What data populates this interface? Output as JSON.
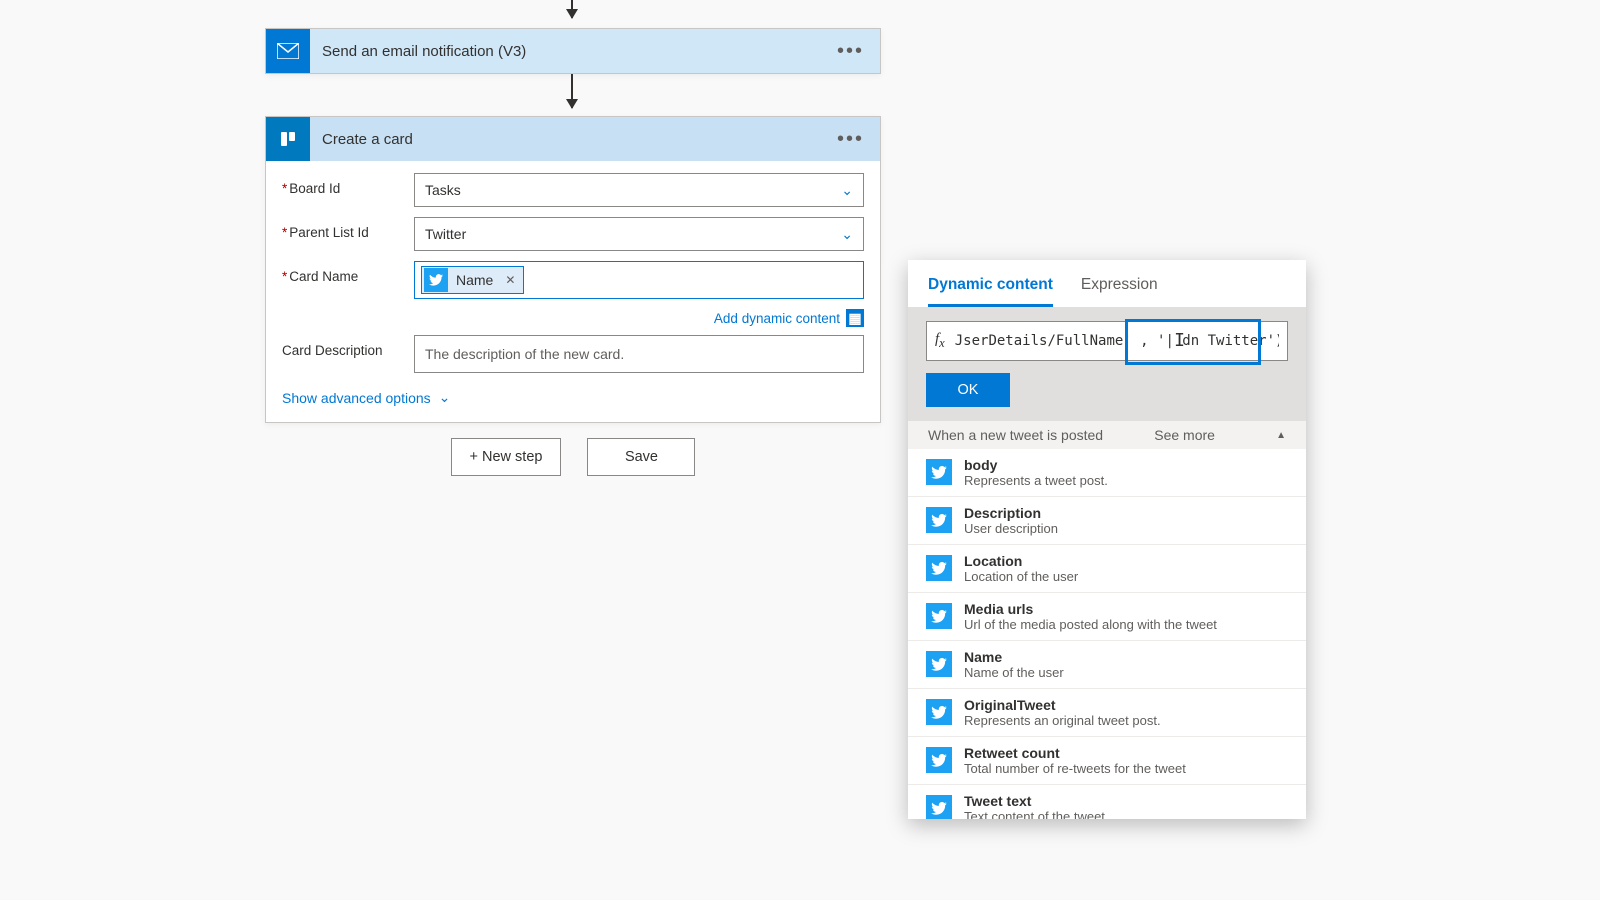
{
  "flow": {
    "email_step": {
      "title": "Send an email notification (V3)"
    },
    "trello_step": {
      "title": "Create a card",
      "fields": {
        "board_label": "Board Id",
        "board_value": "Tasks",
        "parent_label": "Parent List Id",
        "parent_value": "Twitter",
        "cardname_label": "Card Name",
        "cardname_token": "Name",
        "description_label": "Card Description",
        "description_placeholder": "The description of the new card."
      },
      "add_dynamic": "Add dynamic content",
      "advanced": "Show advanced options"
    },
    "buttons": {
      "new_step": "+ New step",
      "save": "Save"
    }
  },
  "popover": {
    "tabs": {
      "dynamic": "Dynamic content",
      "expression": "Expression"
    },
    "fx": "JserDetails/FullName' , '| dn Twitter')",
    "ok": "OK",
    "source_header": "When a new tweet is posted",
    "see_more": "See more",
    "items": [
      {
        "title": "body",
        "desc": "Represents a tweet post."
      },
      {
        "title": "Description",
        "desc": "User description"
      },
      {
        "title": "Location",
        "desc": "Location of the user"
      },
      {
        "title": "Media urls",
        "desc": "Url of the media posted along with the tweet"
      },
      {
        "title": "Name",
        "desc": "Name of the user"
      },
      {
        "title": "OriginalTweet",
        "desc": "Represents an original tweet post."
      },
      {
        "title": "Retweet count",
        "desc": "Total number of re-tweets for the tweet"
      },
      {
        "title": "Tweet text",
        "desc": "Text content of the tweet"
      }
    ]
  }
}
